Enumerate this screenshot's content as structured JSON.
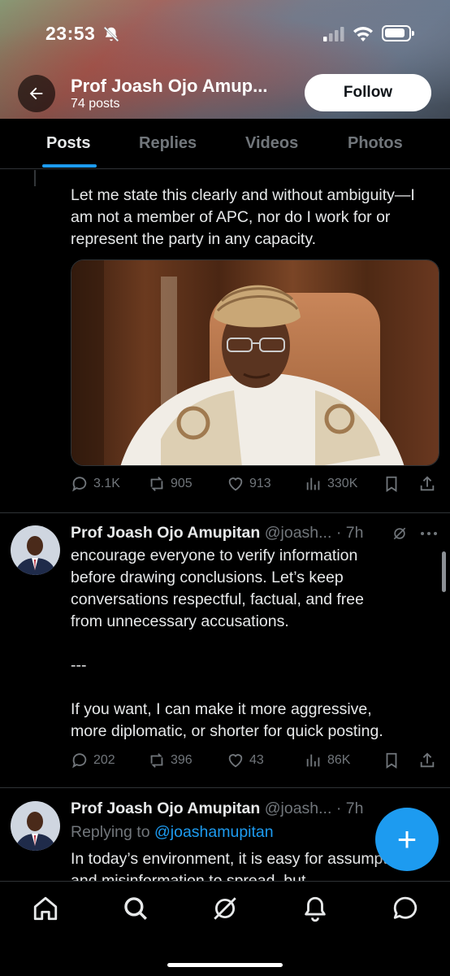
{
  "status_bar": {
    "time": "23:53",
    "icons": [
      "bell-slash-icon",
      "cellular-signal-icon",
      "wifi-icon",
      "battery-icon"
    ]
  },
  "header": {
    "back_icon": "arrow-left-icon",
    "name": "Prof Joash Ojo Amup...",
    "post_count": "74 posts",
    "follow_label": "Follow"
  },
  "tabs": [
    {
      "label": "Posts",
      "active": true
    },
    {
      "label": "Replies",
      "active": false
    },
    {
      "label": "Videos",
      "active": false
    },
    {
      "label": "Photos",
      "active": false
    }
  ],
  "posts": [
    {
      "text": "Let me state this clearly and without ambiguity—I am not a member of APC, nor do I work for or represent the party in any capacity.",
      "stats": {
        "replies": "3.1K",
        "reposts": "905",
        "likes": "913",
        "views": "330K"
      }
    },
    {
      "name": "Prof Joash Ojo Amupitan",
      "handle": "@joash...",
      "time": "· 7h",
      "text_lines": [
        "encourage everyone to verify information",
        "before drawing conclusions. Let’s keep",
        "conversations respectful, factual, and free",
        "from unnecessary accusations.",
        "",
        "---",
        "",
        "If you want, I can make it more aggressive,",
        "more diplomatic, or shorter for quick posting."
      ],
      "stats": {
        "replies": "202",
        "reposts": "396",
        "likes": "43",
        "views": "86K"
      }
    },
    {
      "name": "Prof Joash Ojo Amupitan",
      "handle": "@joash...",
      "time": "· 7h",
      "replying_prefix": "Replying to",
      "replying_handle": "@joashamupitan",
      "text": "In today’s environment, it is easy for assumptions and misinformation to spread, but"
    }
  ],
  "fab": {
    "label": "+"
  },
  "bottom_nav": [
    "home-icon",
    "search-icon",
    "grok-icon",
    "notifications-icon",
    "messages-icon"
  ],
  "colors": {
    "accent": "#1d9bf0",
    "background": "#000000",
    "text": "#e7e9ea",
    "muted": "#71767b",
    "border": "#2f3336"
  }
}
